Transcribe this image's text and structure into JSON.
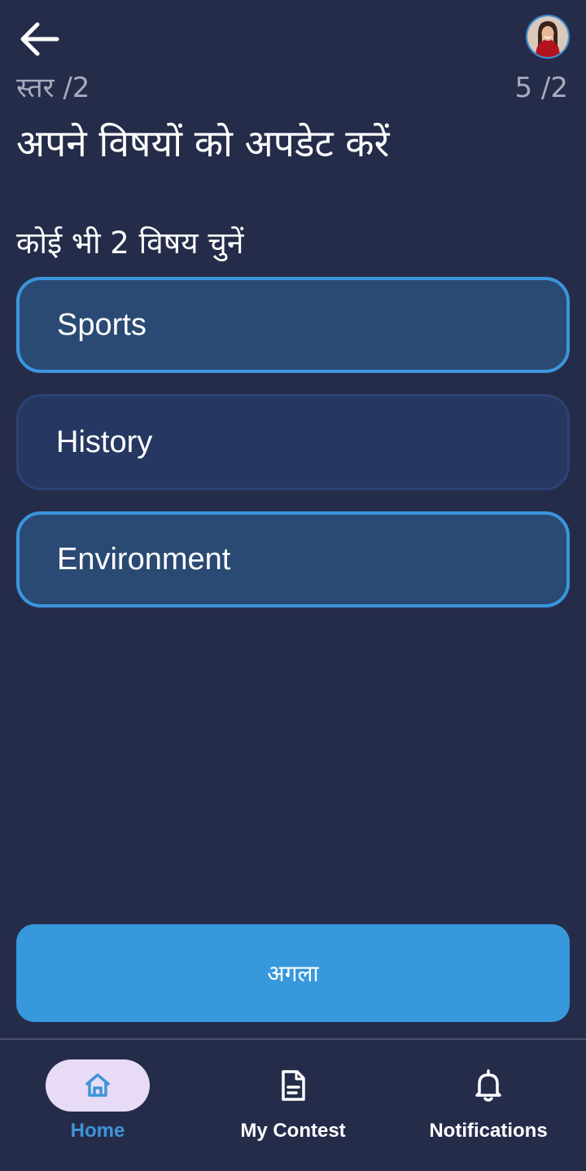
{
  "header": {
    "back_icon": "arrow-left-icon",
    "avatar_icon": "user-avatar",
    "level_label": "स्तर /2",
    "step_count": "5 /2",
    "title": "अपने विषयों को अपडेट करें"
  },
  "instruction": "कोई भी 2 विषय चुनें",
  "options": [
    {
      "label": "Sports",
      "selected": true
    },
    {
      "label": "History",
      "selected": false
    },
    {
      "label": "Environment",
      "selected": true
    }
  ],
  "next_button": {
    "label": "अगला"
  },
  "bottom_nav": {
    "items": [
      {
        "label": "Home",
        "icon": "home-icon",
        "active": true
      },
      {
        "label": "My Contest",
        "icon": "document-icon",
        "active": false
      },
      {
        "label": "Notifications",
        "icon": "bell-icon",
        "active": false
      }
    ]
  },
  "colors": {
    "background": "#252c4a",
    "accent": "#3798dc",
    "selected_border": "#3a96dc",
    "selected_fill": "#2a4a73",
    "unselected_fill": "#263862",
    "active_nav_pill": "#e7dbf6"
  }
}
